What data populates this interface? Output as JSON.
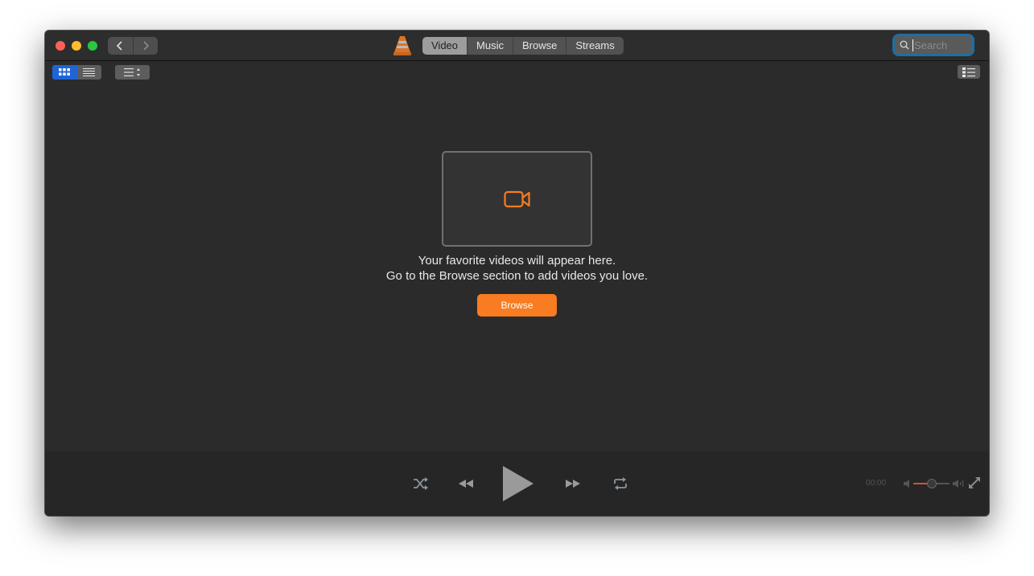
{
  "window": {
    "nav": {
      "back_label": "Back",
      "forward_label": "Forward"
    },
    "tabs": [
      {
        "label": "Video",
        "active": true
      },
      {
        "label": "Music",
        "active": false
      },
      {
        "label": "Browse",
        "active": false
      },
      {
        "label": "Streams",
        "active": false
      }
    ],
    "search": {
      "placeholder": "Search",
      "value": ""
    }
  },
  "toolbar": {
    "view_modes": [
      "grid",
      "list"
    ],
    "active_view": "grid"
  },
  "empty_state": {
    "icon": "video-camera-icon",
    "line1": "Your favorite videos will appear here.",
    "line2": "Go to the Browse section to add videos you love.",
    "browse_button": "Browse"
  },
  "player": {
    "time": "00:00",
    "volume_fraction": 0.5
  },
  "colors": {
    "accent": "#f97c22",
    "selected_view": "#1f64d6",
    "volume_fill": "#d0562b",
    "search_focus": "#1f6ea3"
  }
}
